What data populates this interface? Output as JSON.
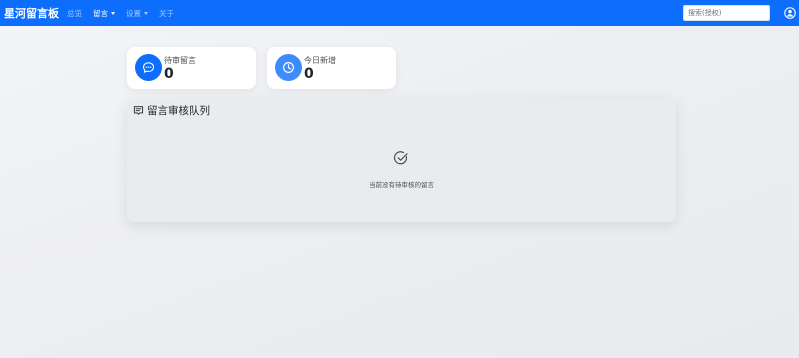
{
  "navbar": {
    "brand": "星河留言板",
    "links": [
      {
        "label": "总览",
        "active": false,
        "dropdown": false
      },
      {
        "label": "留言",
        "active": true,
        "dropdown": true
      },
      {
        "label": "设置",
        "active": false,
        "dropdown": true
      },
      {
        "label": "关于",
        "active": false,
        "dropdown": false
      }
    ],
    "search": {
      "value": "",
      "placeholder": "搜索(授权)"
    },
    "user_icon": "person-circle-icon"
  },
  "stats": {
    "pending": {
      "label": "待审留言",
      "value": "0",
      "icon": "chat-dots-icon",
      "color": "#0d6efd"
    },
    "today": {
      "label": "今日新增",
      "value": "0",
      "icon": "clock-icon",
      "color": "#3d8bfd"
    }
  },
  "queue": {
    "title": "留言审核队列",
    "title_icon": "chat-square-text-icon",
    "empty_icon": "check-circle-icon",
    "empty_text": "当前没有待审核的留言"
  },
  "colors": {
    "primary": "#0d6efd"
  }
}
